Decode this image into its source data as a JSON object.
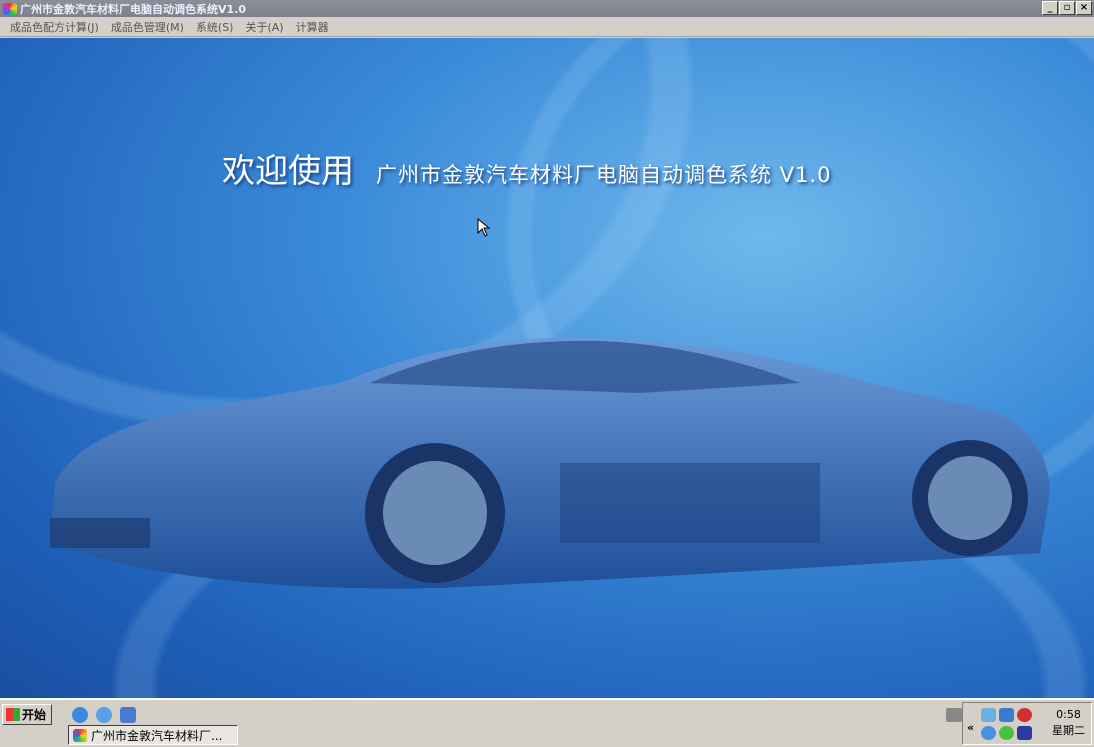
{
  "window": {
    "title": "广州市金敦汽车材料厂电脑自动调色系统V1.0",
    "min": "_",
    "max": "▫",
    "close": "×"
  },
  "menu": [
    "成品色配方计算(J)",
    "成品色管理(M)",
    "系统(S)",
    "关于(A)",
    "计算器"
  ],
  "welcome": {
    "big": "欢迎使用",
    "sub": "广州市金敦汽车材料厂电脑自动调色系统 V1.0"
  },
  "taskbar": {
    "start": "开始",
    "task": "广州市金敦汽车材料厂...",
    "expand": "«",
    "time": "0:58",
    "day": "星期二"
  }
}
